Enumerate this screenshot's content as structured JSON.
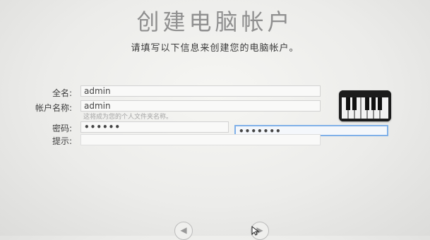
{
  "window": {
    "title": "创建电脑帐户",
    "subtitle": "请填写以下信息来创建您的电脑帐户。"
  },
  "form": {
    "fullname": {
      "label": "全名:",
      "value": "admin"
    },
    "account": {
      "label": "帐户名称:",
      "value": "admin",
      "hint": "这将成为您的个人文件夹名称。"
    },
    "password": {
      "label": "密码:",
      "value": "••••••"
    },
    "verify": {
      "value": "•••••••"
    },
    "hint_field": {
      "label": "提示:",
      "value": ""
    }
  },
  "avatar": {
    "icon": "piano-keys-icon"
  },
  "navigation": {
    "back_icon": "back-arrow-icon",
    "forward_icon": "forward-arrow-icon"
  }
}
